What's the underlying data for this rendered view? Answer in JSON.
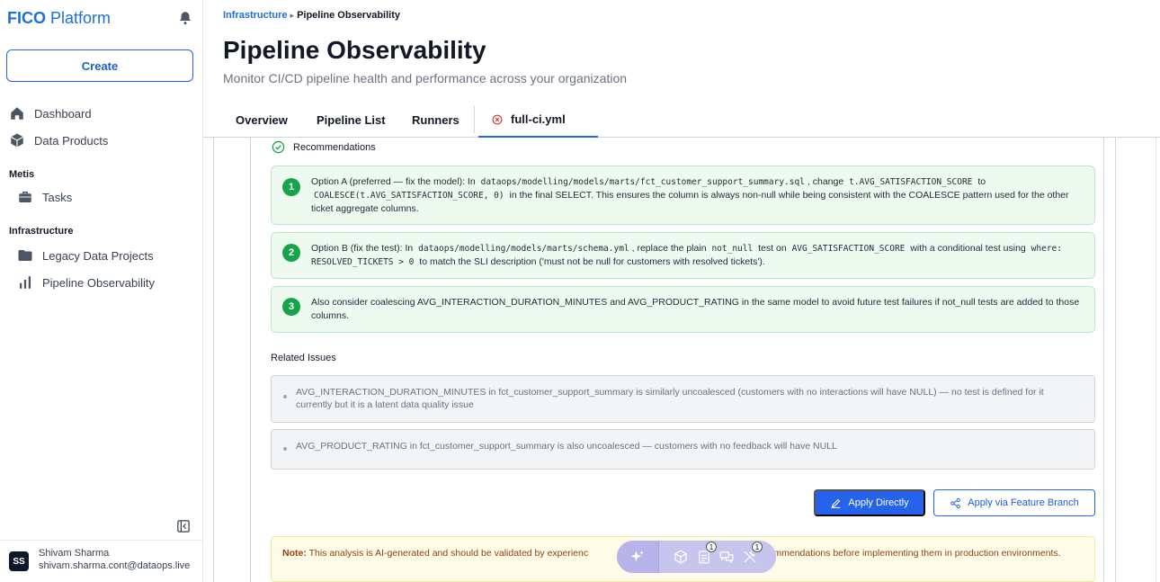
{
  "sidebar": {
    "brand_bold": "FICO",
    "brand_rest": "Platform",
    "create_label": "Create",
    "items": [
      {
        "label": "Dashboard",
        "icon": "home-icon"
      },
      {
        "label": "Data Products",
        "icon": "cube-icon"
      }
    ],
    "section_metis": "Metis",
    "metis_items": [
      {
        "label": "Tasks",
        "icon": "briefcase-icon"
      }
    ],
    "section_infra": "Infrastructure",
    "infra_items": [
      {
        "label": "Legacy Data Projects",
        "icon": "folder-icon"
      },
      {
        "label": "Pipeline Observability",
        "icon": "bar-chart-icon"
      }
    ],
    "user": {
      "initials": "SS",
      "name": "Shivam Sharma",
      "email": "shivam.sharma.cont@dataops.live"
    }
  },
  "breadcrumb": {
    "parent": "Infrastructure",
    "separator": "▸",
    "current": "Pipeline Observability"
  },
  "page": {
    "title": "Pipeline Observability",
    "subtitle": "Monitor CI/CD pipeline health and performance across your organization"
  },
  "tabs": [
    {
      "label": "Overview"
    },
    {
      "label": "Pipeline List"
    },
    {
      "label": "Runners"
    },
    {
      "label": "full-ci.yml",
      "active": true
    }
  ],
  "recommendations": {
    "heading": "Recommendations",
    "items": [
      {
        "num": "1",
        "t1": "Option A (preferred — fix the model): In ",
        "c1": "dataops/modelling/models/marts/fct_customer_support_summary.sql",
        "t2": ", change ",
        "c2": "t.AVG_SATISFACTION_SCORE",
        "t3": " to ",
        "c3": "COALESCE(t.AVG_SATISFACTION_SCORE, 0)",
        "t4": " in the final SELECT. This ensures the column is always non-null while being consistent with the COALESCE pattern used for the other ticket aggregate columns."
      },
      {
        "num": "2",
        "t1": "Option B (fix the test): In ",
        "c1": "dataops/modelling/models/marts/schema.yml",
        "t2": ", replace the plain ",
        "c2": "not_null",
        "t3": " test on ",
        "c3": "AVG_SATISFACTION_SCORE",
        "t4": " with a conditional test using ",
        "c4": "where: RESOLVED_TICKETS > 0",
        "t5": " to match the SLI description ('must not be null for customers with resolved tickets')."
      },
      {
        "num": "3",
        "t1": "Also consider coalescing AVG_INTERACTION_DURATION_MINUTES and AVG_PRODUCT_RATING in the same model to avoid future test failures if not_null tests are added to those columns."
      }
    ]
  },
  "related": {
    "heading": "Related Issues",
    "items": [
      "AVG_INTERACTION_DURATION_MINUTES in fct_customer_support_summary is similarly uncoalesced (customers with no interactions will have NULL) — no test is defined for it currently but it is a latent data quality issue",
      "AVG_PRODUCT_RATING in fct_customer_support_summary is also uncoalesced — customers with no feedback will have NULL"
    ]
  },
  "actions": {
    "apply_directly": "Apply Directly",
    "apply_branch": "Apply via Feature Branch"
  },
  "note": {
    "label": "Note:",
    "text_before": " This analysis is AI-generated and should be validated by experienc",
    "text_after": "test recommendations before implementing them in production environments."
  },
  "toolbar": {
    "badge_clipboard": "1",
    "badge_tools": "1"
  },
  "colors": {
    "brand": "#1d6fd6",
    "primary": "#2563eb",
    "success": "#16a34a",
    "note_bg": "#fefce8",
    "toolbar_bg": "#c7c4ee"
  }
}
